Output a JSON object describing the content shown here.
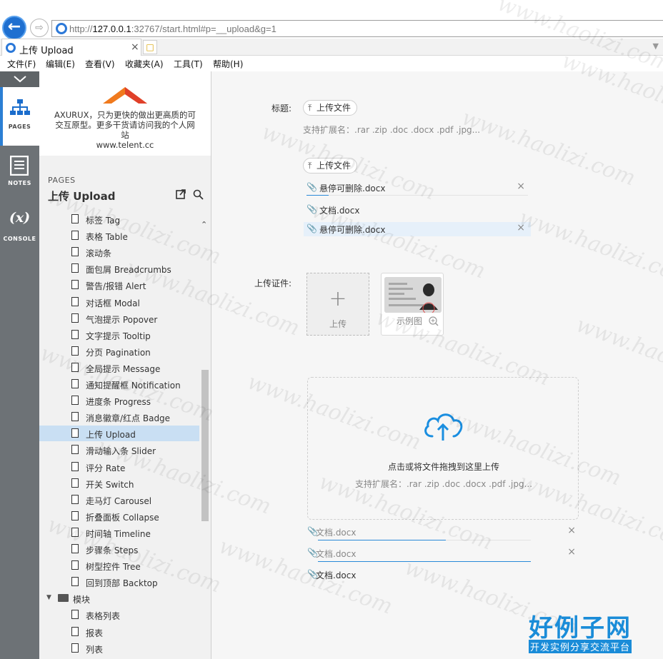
{
  "browser": {
    "url_prefix": "http://",
    "url_host": "127.0.0.1",
    "url_rest": ":32767/start.html#p=__upload&g=1",
    "tab_title": "上传 Upload",
    "tab_close": "×"
  },
  "menu": {
    "items": [
      "文件(F)",
      "编辑(E)",
      "查看(V)",
      "收藏夹(A)",
      "工具(T)",
      "帮助(H)"
    ]
  },
  "rail": {
    "pages_label": "PAGES",
    "notes_label": "NOTES",
    "console_label": "CONSOLE",
    "console_glyph": "(x)"
  },
  "panel": {
    "logo_text": "AXURUX，只为更快的做出更高质的可交互原型。更多干货请访问我的个人网站",
    "logo_site": "www.telent.cc",
    "pages_heading": "PAGES",
    "current_page": "上传 Upload",
    "tree": [
      {
        "label": "标签 Tag",
        "type": "page"
      },
      {
        "label": "表格 Table",
        "type": "page"
      },
      {
        "label": "滚动条",
        "type": "page"
      },
      {
        "label": "面包屑 Breadcrumbs",
        "type": "page"
      },
      {
        "label": "警告/报错 Alert",
        "type": "page"
      },
      {
        "label": "对话框 Modal",
        "type": "page"
      },
      {
        "label": "气泡提示 Popover",
        "type": "page"
      },
      {
        "label": "文字提示 Tooltip",
        "type": "page"
      },
      {
        "label": "分页 Pagination",
        "type": "page"
      },
      {
        "label": "全局提示 Message",
        "type": "page"
      },
      {
        "label": "通知提醒框 Notification",
        "type": "page"
      },
      {
        "label": "进度条 Progress",
        "type": "page"
      },
      {
        "label": "消息徽章/红点 Badge",
        "type": "page"
      },
      {
        "label": "上传 Upload",
        "type": "page",
        "selected": true
      },
      {
        "label": "滑动输入条 Slider",
        "type": "page"
      },
      {
        "label": "评分 Rate",
        "type": "page"
      },
      {
        "label": "开关 Switch",
        "type": "page"
      },
      {
        "label": "走马灯 Carousel",
        "type": "page"
      },
      {
        "label": "折叠面板 Collapse",
        "type": "page"
      },
      {
        "label": "时间轴 Timeline",
        "type": "page"
      },
      {
        "label": "步骤条 Steps",
        "type": "page"
      },
      {
        "label": "树型控件 Tree",
        "type": "page"
      },
      {
        "label": "回到顶部 Backtop",
        "type": "page"
      },
      {
        "label": "模块",
        "type": "folder"
      },
      {
        "label": "表格列表",
        "type": "page"
      },
      {
        "label": "报表",
        "type": "page"
      },
      {
        "label": "列表",
        "type": "page"
      }
    ]
  },
  "main": {
    "title_label": "标题:",
    "upload_btn_1": "上传文件",
    "ext_hint_1": "支持扩展名：.rar .zip .doc .docx .pdf .jpg...",
    "upload_btn_2": "上传文件",
    "file_list_1": [
      {
        "name": "悬停可删除.docx",
        "remove": "×",
        "progress": 0.1
      },
      {
        "name": "文档.docx"
      },
      {
        "name": "悬停可删除.docx",
        "remove": "×",
        "hover": true
      }
    ],
    "id_label": "上传证件:",
    "upload_card_plus": "+",
    "upload_card_label": "上传",
    "sample_label": "示例图",
    "drag_title": "点击或将文件拖拽到这里上传",
    "drag_hint": "支持扩展名：.rar .zip .doc .docx .pdf .jpg...",
    "file_list_2": [
      {
        "name": "文档.docx",
        "remove": "×",
        "progress": 0.6
      },
      {
        "name": "文档.docx",
        "remove": "×",
        "progress": 1.0
      },
      {
        "name": "文档.docx"
      }
    ]
  },
  "watermark": {
    "text": "www.haolizi.com",
    "logo_big": "好例子网",
    "logo_small": "开发实例分享交流平台"
  },
  "colors": {
    "accent": "#2989d8",
    "selected_row": "#c9dff3",
    "rail": "#6d7276",
    "logo_orange": "#f07a1e"
  }
}
